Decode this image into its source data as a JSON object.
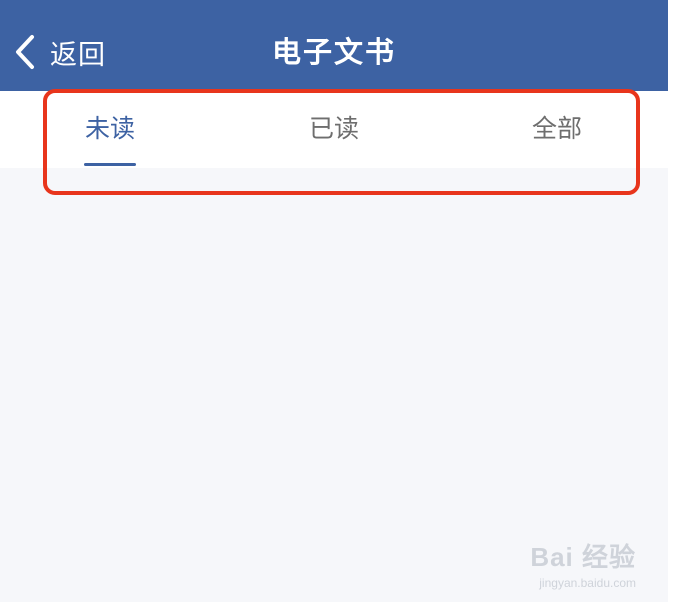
{
  "header": {
    "back_label": "返回",
    "title": "电子文书",
    "background": "#3d62a3"
  },
  "tabs": [
    {
      "label": "未读",
      "active": true
    },
    {
      "label": "已读",
      "active": false
    },
    {
      "label": "全部",
      "active": false
    }
  ],
  "colors": {
    "accent": "#3d62a3",
    "highlight": "#e8351c",
    "content_bg": "#f6f7fa"
  },
  "watermark": {
    "main": "Bai 经验",
    "sub": "jingyan.baidu.com"
  },
  "icons": {
    "back": "chevron-left-icon"
  }
}
